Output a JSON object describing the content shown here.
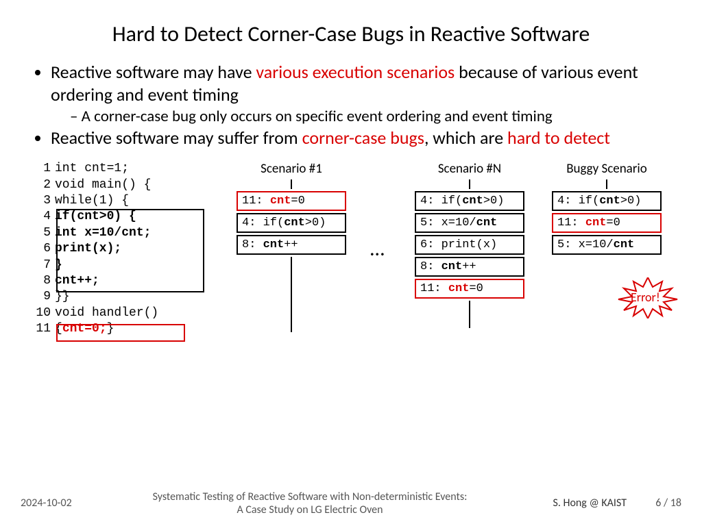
{
  "title": "Hard to Detect Corner-Case Bugs in Reactive Software",
  "bullets": {
    "b1a": "Reactive software may have ",
    "b1b": "various execution scenarios",
    "b1c": " because of various event ordering and event timing",
    "b1_1": "A corner-case bug only occurs on specific event ordering and event timing",
    "b2a": "Reactive software may suffer from ",
    "b2b": "corner-case bugs",
    "b2c": ", which are ",
    "b2d": "hard to detect"
  },
  "code": {
    "l1": "int cnt=1;",
    "l2": "void main() {",
    "l3": " while(1) {",
    "l4": "  if(cnt>0) {",
    "l5": "   int x=10/cnt;",
    "l6": "   print(x);",
    "l7": "  }",
    "l8": "  cnt++;",
    "l9": "}}",
    "l10": "void handler()",
    "l11a": "{ ",
    "l11b": "cnt=0;",
    "l11c": " }",
    "ln1": "1",
    "ln2": "2",
    "ln3": "3",
    "ln4": "4",
    "ln5": "5",
    "ln6": "6",
    "ln7": "7",
    "ln8": "8",
    "ln9": "9",
    "ln10": "10",
    "ln11": "11"
  },
  "scenarios": {
    "s1": {
      "title": "Scenario #1",
      "r1_ln": "11:",
      "r1_code_a": "cnt",
      "r1_code_b": "=0",
      "r2_ln": "4:",
      "r2_code_a": "if(",
      "r2_code_b": "cnt",
      "r2_code_c": ">0)",
      "r3_ln": "8:",
      "r3_code_a": "cnt",
      "r3_code_b": "++"
    },
    "sN": {
      "title": "Scenario #N",
      "r1_ln": "4:",
      "r1_code_a": "if(",
      "r1_code_b": "cnt",
      "r1_code_c": ">0)",
      "r2_ln": "5:",
      "r2_code_a": "x=10/",
      "r2_code_b": "cnt",
      "r3_ln": "6:",
      "r3_code": "print(x)",
      "r4_ln": "8:",
      "r4_code_a": "cnt",
      "r4_code_b": "++",
      "r5_ln": "11:",
      "r5_code_a": "cnt",
      "r5_code_b": "=0"
    },
    "buggy": {
      "title": "Buggy Scenario",
      "r1_ln": "4:",
      "r1_code_a": "if(",
      "r1_code_b": "cnt",
      "r1_code_c": ">0)",
      "r2_ln": "11:",
      "r2_code_a": "cnt",
      "r2_code_b": "=0",
      "r3_ln": "5:",
      "r3_code_a": "x=10/",
      "r3_code_b": "cnt"
    }
  },
  "dots": "…",
  "error": "Error!",
  "footer": {
    "date": "2024-10-02",
    "title1": "Systematic Testing of Reactive Software with Non-deterministic Events:",
    "title2": "A Case Study on LG Electric Oven",
    "author": "S. Hong @ KAIST",
    "page": "6 / 18"
  }
}
